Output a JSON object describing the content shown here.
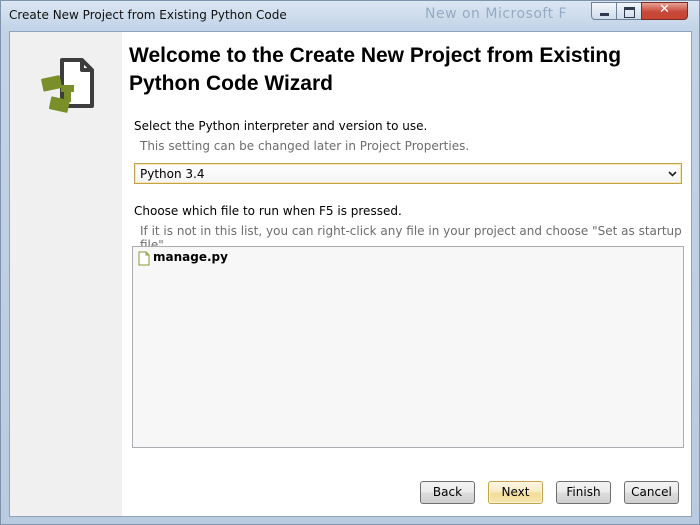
{
  "window": {
    "title": "Create New Project from Existing Python Code",
    "background_title": "New on Microsoft F"
  },
  "titlebar_buttons": {
    "minimize": "minimize-icon",
    "maximize": "maximize-icon",
    "close": "close-icon",
    "close_glyph": "✕"
  },
  "sidebar": {
    "icon": "python-wizard-icon"
  },
  "heading": "Welcome to the Create New Project from Existing Python Code Wizard",
  "interpreter": {
    "label": "Select the Python interpreter and version to use.",
    "hint": "This setting can be changed later in Project Properties.",
    "selected": "Python 3.4"
  },
  "startup": {
    "label": "Choose which file to run when F5 is pressed.",
    "hint": "If it is not in this list, you can right-click any file in your project and choose \"Set as startup file\"",
    "files": [
      {
        "name": "manage.py",
        "icon": "python-file-icon"
      }
    ]
  },
  "buttons": {
    "back": "Back",
    "next": "Next",
    "finish": "Finish",
    "cancel": "Cancel"
  },
  "colors": {
    "accent_green": "#7a8f2a",
    "dark_gray": "#3d3d3d",
    "focus_gold": "#c2a34a"
  }
}
